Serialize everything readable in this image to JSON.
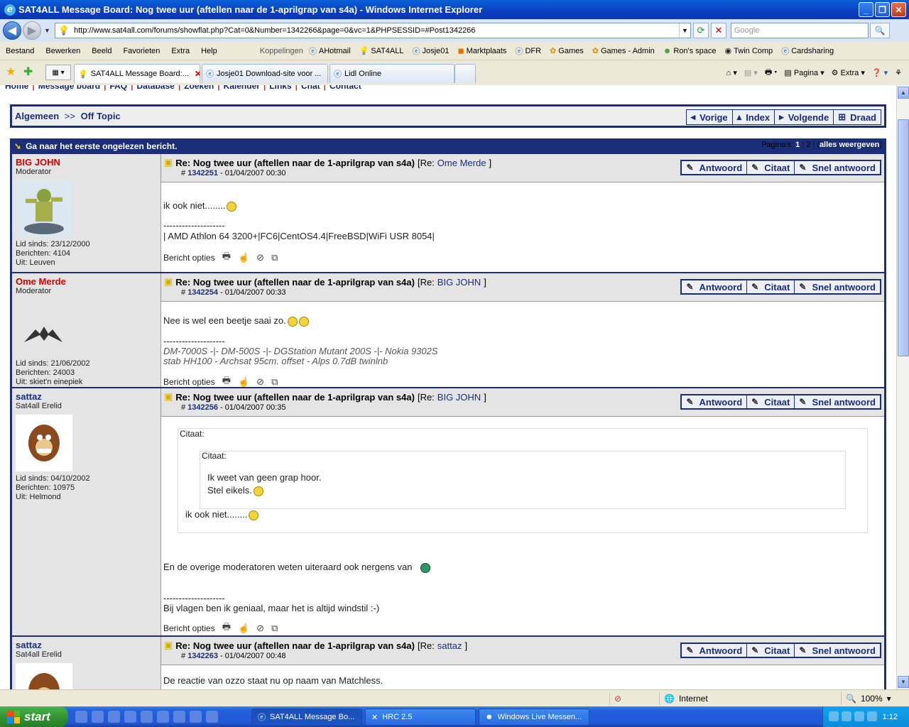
{
  "window": {
    "title": "SAT4ALL Message Board: Nog twee uur (aftellen naar de 1-aprilgrap van s4a) - Windows Internet Explorer"
  },
  "address": {
    "url": "http://www.sat4all.com/forums/showflat.php?Cat=0&Number=1342266&page=0&vc=1&PHPSESSID=#Post1342266",
    "search_placeholder": "Google"
  },
  "menu": [
    "Bestand",
    "Bewerken",
    "Beeld",
    "Favorieten",
    "Extra",
    "Help"
  ],
  "links": {
    "label": "Koppelingen",
    "items": [
      "AHotmail",
      "SAT4ALL",
      "Josje01",
      "Marktplaats",
      "DFR",
      "Games",
      "Games - Admin",
      "Ron's space",
      "Twin Comp",
      "Cardsharing"
    ]
  },
  "tabs": [
    {
      "label": "SAT4ALL Message Board:..."
    },
    {
      "label": "Josje01 Download-site voor ..."
    },
    {
      "label": "Lidl Online"
    }
  ],
  "tools": {
    "page": "Pagina",
    "extra": "Extra"
  },
  "site_nav": [
    "Home",
    "Message board",
    "FAQ",
    "Database",
    "Zoeken",
    "Kalender",
    "Links",
    "Chat",
    "Contact"
  ],
  "crumbs": {
    "root": "Algemeen",
    "sep": ">>",
    "current": "Off Topic"
  },
  "thread_nav": [
    "Vorige",
    "Index",
    "Volgende",
    "Draad"
  ],
  "thread": {
    "first_unread": "Ga naar het eerste ongelezen bericht.",
    "pages_label": "Pagina's:",
    "page1": "1",
    "page2": "2",
    "all": "alles weergeven"
  },
  "actions": {
    "reply": "Antwoord",
    "quote": "Citaat",
    "quick": "Snel antwoord",
    "options": "Bericht opties"
  },
  "posts": [
    {
      "user": "BIG JOHN",
      "role": "Moderator",
      "joined": "Lid sinds: 23/12/2000",
      "posts": "Berichten: 4104",
      "from": "Uit: Leuven",
      "title": "Re: Nog twee uur (aftellen naar de 1-aprilgrap van s4a)",
      "re_prefix": "[Re:",
      "re_name": "Ome Merde",
      "re_suffix": "]",
      "hash": "#",
      "num": "1342251",
      "date": "- 01/04/2007 00:30",
      "body": "ik ook niet........",
      "sig_line": "--------------------",
      "sig": "| AMD Athlon 64 3200+|FC6|CentOS4.4|FreeBSD|WiFi USR 8054|"
    },
    {
      "user": "Ome Merde",
      "role": "Moderator",
      "joined": "Lid sinds: 21/06/2002",
      "posts": "Berichten: 24003",
      "from": "Uit: skiet'n einepiek",
      "title": "Re: Nog twee uur (aftellen naar de 1-aprilgrap van s4a)",
      "re_prefix": "[Re:",
      "re_name": "BIG JOHN",
      "re_suffix": "]",
      "hash": "#",
      "num": "1342254",
      "date": "- 01/04/2007 00:33",
      "body": "Nee is wel een beetje saai zo.",
      "sig_line": "--------------------",
      "sig1": "DM-7000S -|- DM-500S -|- DGStation Mutant 200S -|- Nokia 9302S",
      "sig2": "stab HH100 - Archsat 95cm. offset - Alps 0.7dB twinlnb"
    },
    {
      "user": "sattaz",
      "role": "Sat4all Erelid",
      "joined": "Lid sinds: 04/10/2002",
      "posts": "Berichten: 10975",
      "from": "Uit: Helmond",
      "title": "Re: Nog twee uur (aftellen naar de 1-aprilgrap van s4a)",
      "re_prefix": "[Re:",
      "re_name": "BIG JOHN",
      "re_suffix": "]",
      "hash": "#",
      "num": "1342256",
      "date": "- 01/04/2007 00:35",
      "quote_label": "Citaat:",
      "inner_quote_label": "Citaat:",
      "inner_line1": "Ik weet van geen grap hoor.",
      "inner_line2": "Stel eikels.",
      "outer_line": "ik ook niet........",
      "body": "En de overige moderatoren weten uiteraard ook nergens van",
      "sig_line": "--------------------",
      "sig": "Bij vlagen ben ik geniaal, maar het is altijd windstil :-)"
    },
    {
      "user": "sattaz",
      "role": "Sat4all Erelid",
      "title": "Re: Nog twee uur (aftellen naar de 1-aprilgrap van s4a)",
      "re_prefix": "[Re:",
      "re_name": "sattaz",
      "re_suffix": "]",
      "hash": "#",
      "num": "1342263",
      "date": "- 01/04/2007 00:48",
      "body": "De reactie van ozzo staat nu op naam van Matchless."
    }
  ],
  "status": {
    "zone": "Internet",
    "zoom": "100%"
  },
  "taskbar": {
    "start": "start",
    "tasks": [
      "SAT4ALL Message Bo...",
      "HRC 2.5",
      "Windows Live Messen..."
    ],
    "clock": "1:12"
  }
}
